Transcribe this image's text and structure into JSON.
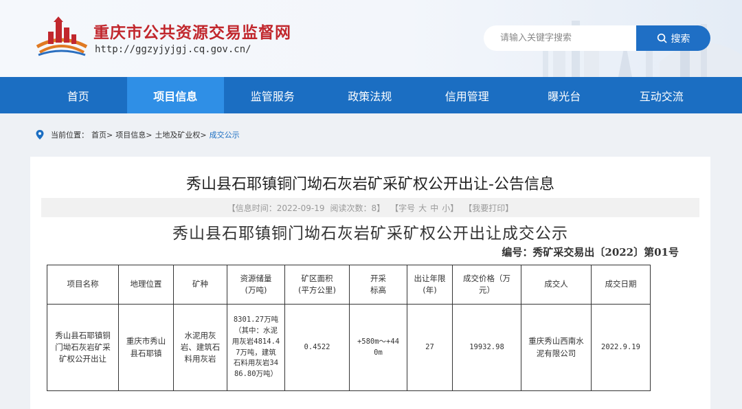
{
  "site": {
    "title": "重庆市公共资源交易监督网",
    "url": "http://ggzyjyjgj.cq.gov.cn/"
  },
  "search": {
    "placeholder": "请输入关键字搜索",
    "button_label": "搜索"
  },
  "nav": {
    "items": [
      {
        "label": "首页",
        "active": false
      },
      {
        "label": "项目信息",
        "active": true
      },
      {
        "label": "监管服务",
        "active": false
      },
      {
        "label": "政策法规",
        "active": false
      },
      {
        "label": "信用管理",
        "active": false
      },
      {
        "label": "曝光台",
        "active": false
      },
      {
        "label": "互动交流",
        "active": false
      }
    ]
  },
  "breadcrumb": {
    "prefix": "当前位置：",
    "items": [
      "首页>",
      "项目信息>",
      "土地及矿业权>"
    ],
    "current": "成交公示"
  },
  "article": {
    "title": "秀山县石耶镇铜门坳石灰岩矿采矿权公开出让-公告信息",
    "info": {
      "time_label": "【信息时间：2022-09-19",
      "views_label": "阅读次数：8】",
      "font_label": "【字号",
      "font_large": "大",
      "font_medium": "中",
      "font_small": "小】",
      "print_label": "【我要打印】"
    },
    "doc_title": "秀山县石耶镇铜门坳石灰岩矿采矿权公开出让成交公示",
    "doc_no": "编号：秀矿采交易出〔2022〕第01号"
  },
  "table": {
    "headers": [
      "项目名称",
      "地理位置",
      "矿种",
      "资源储量\n(万吨)",
      "矿区面积\n(平方公里)",
      "开采\n标高",
      "出让年限\n(年)",
      "成交价格（万\n元）",
      "成交人",
      "成交日期"
    ],
    "rows": [
      [
        "秀山县石耶镇铜\n门坳石灰岩矿采\n矿权公开出让",
        "重庆市秀山\n县石耶镇",
        "水泥用灰\n岩、建筑石\n料用灰岩",
        "8301.27万吨\n（其中：水泥\n用灰岩4814.4\n7万吨，建筑\n石料用灰岩34\n86.80万吨）",
        "0.4522",
        "+580m～+44\n0m",
        "27",
        "19932.98",
        "重庆秀山西南水\n泥有限公司",
        "2022.9.19"
      ]
    ]
  },
  "colors": {
    "brand_red": "#c1272d",
    "nav_blue": "#1b6ec2",
    "nav_active": "#2f8fe6",
    "search_button": "#1f6fc5"
  },
  "icons": [
    "logo-emblem",
    "search-icon",
    "location-pin-icon"
  ]
}
